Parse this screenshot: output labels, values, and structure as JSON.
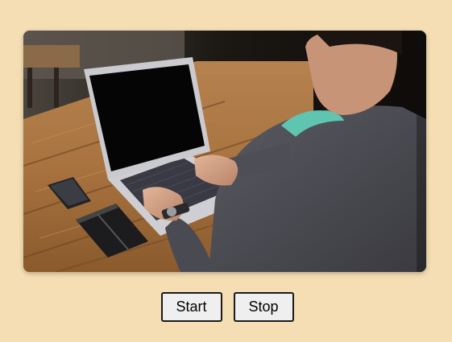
{
  "image": {
    "alt": "",
    "colors": {
      "background": "#f5deb3",
      "table": "#a9784a",
      "table_light": "#c9955f",
      "laptop_body": "#c8c8cc",
      "laptop_screen": "#050505",
      "sweater": "#4a4a52",
      "scarf": "#5fc4b0"
    }
  },
  "controls": {
    "start_label": "Start",
    "stop_label": "Stop"
  }
}
